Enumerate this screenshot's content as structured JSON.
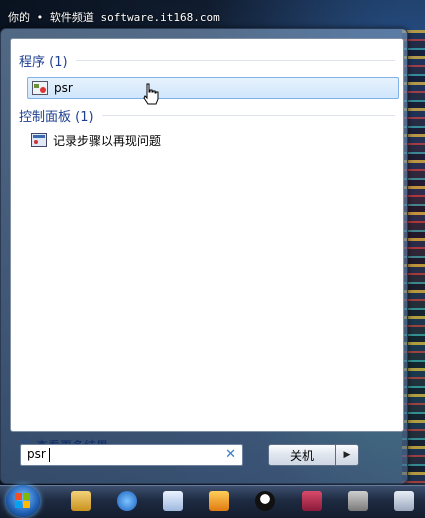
{
  "watermark": "你的 • 软件频道 software.it168.com",
  "start_menu": {
    "groups": [
      {
        "title": "程序 (1)",
        "items": [
          {
            "label": "psr",
            "icon": "program-icon"
          }
        ]
      },
      {
        "title": "控制面板 (1)",
        "items": [
          {
            "label": "记录步骤以再现问题",
            "icon": "steps-recorder-icon"
          }
        ]
      }
    ],
    "see_more": "查看更多结果",
    "search": {
      "value": "psr"
    },
    "shutdown_label": "关机",
    "shutdown_arrow": "▶"
  },
  "taskbar": {
    "items": [
      "explorer-icon",
      "ie-icon",
      "notepad-icon",
      "media-player-icon",
      "qq-icon",
      "winrar-icon",
      "network-icon",
      "device-icon"
    ]
  },
  "colors": {
    "accent": "#1e3f8f",
    "selection": "#cfe6fb",
    "link": "#0d2a66"
  }
}
